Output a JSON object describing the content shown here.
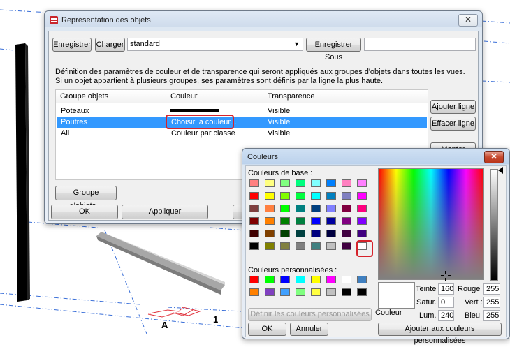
{
  "main_window": {
    "title": "Représentation des objets",
    "buttons": {
      "save": "Enregistrer",
      "load": "Charger",
      "save_as": "Enregistrer Sous"
    },
    "preset_value": "standard",
    "save_as_value": "",
    "description_line1": "Définition des paramètres de couleur et de transparence qui seront appliqués aux groupes d'objets dans toutes les vues.",
    "description_line2": "Si un objet appartient à plusieurs groupes, ses paramètres sont définis par la ligne la plus haute.",
    "columns": [
      "Groupe objets",
      "Couleur",
      "Transparence"
    ],
    "rows": [
      {
        "group": "Poteaux",
        "color": "",
        "transparency": "Visible"
      },
      {
        "group": "Poutres",
        "color": "Choisir la couleur...",
        "transparency": "Visible"
      },
      {
        "group": "All",
        "color": "Couleur par classe",
        "transparency": "Visible"
      }
    ],
    "side_buttons": {
      "add_row": "Ajouter ligne",
      "delete_row": "Effacer ligne",
      "move_up": "Monter"
    },
    "object_groups_button": "Groupe d'objets...",
    "ok": "OK",
    "apply": "Appliquer",
    "modify_partial": "M"
  },
  "color_dialog": {
    "title": "Couleurs",
    "basic_colors_label": "Couleurs de base :",
    "basic_colors": [
      "#ff8080",
      "#ffff80",
      "#80ff80",
      "#00ff80",
      "#80ffff",
      "#0080ff",
      "#ff80c0",
      "#ff80ff",
      "#ff0000",
      "#ffff00",
      "#80ff00",
      "#00ff40",
      "#00ffff",
      "#0080c0",
      "#8080c0",
      "#ff00ff",
      "#804040",
      "#ff8040",
      "#00ff00",
      "#008080",
      "#004080",
      "#8080ff",
      "#800040",
      "#ff0080",
      "#800000",
      "#ff8000",
      "#008000",
      "#008040",
      "#0000ff",
      "#0000a0",
      "#800080",
      "#8000ff",
      "#400000",
      "#804000",
      "#004000",
      "#004040",
      "#000080",
      "#000040",
      "#400040",
      "#400080",
      "#000000",
      "#808000",
      "#808040",
      "#808080",
      "#408080",
      "#c0c0c0",
      "#400040",
      "#ffffff"
    ],
    "custom_colors_label": "Couleurs personnalisées :",
    "custom_colors": [
      "#ff0000",
      "#00ff00",
      "#0000ff",
      "#00ffff",
      "#ffff00",
      "#ff00ff",
      "#ffffff",
      "#4080c0",
      "#ff8000",
      "#8040c0",
      "#40a0ff",
      "#80ff80",
      "#ffff40",
      "#c0c0c0",
      "#000000",
      "#000000"
    ],
    "define_custom_button": "Définir les couleurs personnalisées >>",
    "ok": "OK",
    "cancel": "Annuler",
    "color_label": "Couleur",
    "hue_label": "Teinte :",
    "hue": "160",
    "sat_label": "Satur. :",
    "sat": "0",
    "lum_label": "Lum. :",
    "lum": "240",
    "red_label": "Rouge :",
    "red": "255",
    "green_label": "Vert :",
    "green": "255",
    "blue_label": "Bleu :",
    "blue": "255",
    "add_custom_button": "Ajouter aux couleurs personnalisées"
  },
  "scene": {
    "label_a": "A",
    "label_1": "1"
  }
}
